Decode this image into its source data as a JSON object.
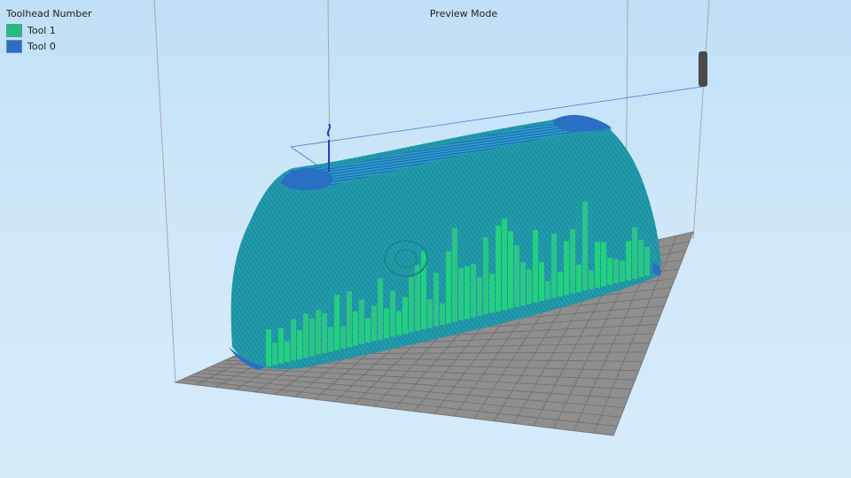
{
  "header": {
    "mode_label": "Preview Mode"
  },
  "legend": {
    "title": "Toolhead Number",
    "items": [
      {
        "label": "Tool 1",
        "color": "#22c07a"
      },
      {
        "label": "Tool 0",
        "color": "#2a6fc4"
      }
    ]
  },
  "colors": {
    "background": "#cfe7f9",
    "build_plate": "#8e8e8e",
    "grid_line": "#6f6f6f",
    "model_teal": "#1aa6a0",
    "support_green": "#22d47a",
    "brim_blue": "#2a6fc4",
    "extruder": "#4a4a4a"
  }
}
